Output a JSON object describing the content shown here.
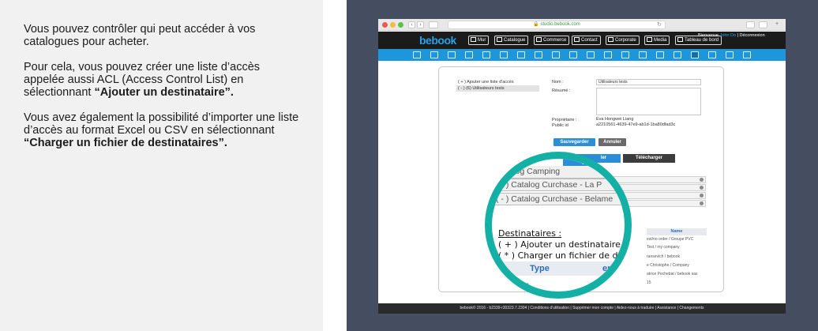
{
  "intro": {
    "p1": "Vous pouvez contrôler qui peut accéder à vos catalogues pour acheter.",
    "p2_prefix": "Pour cela, vous pouvez créer une liste d’accès appelée aussi ACL (Access Control List) en sélectionnant ",
    "p2_bold": "“Ajouter un destinataire”.",
    "p3_prefix": "Vous avez également la possibilité d’importer une liste d’accès au format Excel ou CSV en sélectionnant ",
    "p3_bold": "“Charger un fichier de destinataires”."
  },
  "browser": {
    "url": "studio.bebook.com"
  },
  "app": {
    "logo": "bebook",
    "menu": [
      {
        "label": "Mur",
        "icon": "edit-icon"
      },
      {
        "label": "Catalogue",
        "icon": "catalog-icon"
      },
      {
        "label": "Commerce",
        "icon": "cart-icon"
      },
      {
        "label": "Contact",
        "icon": "contacts-icon"
      },
      {
        "label": "Corporate",
        "icon": "corporate-icon"
      },
      {
        "label": "Media",
        "icon": "media-icon"
      },
      {
        "label": "Tableau de bord",
        "icon": "dashboard-icon"
      }
    ],
    "user": {
      "line1_a": "Bienvenue",
      "line1_b": "John Do",
      "line1_c": "Déconnexion"
    }
  },
  "form": {
    "acl_items": [
      "( + ) Ajouter une liste d'accès",
      "( - ) (6) Utilisateurs tests"
    ],
    "nom_label": "Nom :",
    "nom_value": "Utilisateurs tests",
    "resume_label": "Résumé :",
    "proprietaire_label": "Propriétaire :",
    "proprietaire_value": "Eva Hongwei Liang",
    "public_id_label": "Public id",
    "public_id_value": "a2210561-4639-47e9-ab1d-1ba80dfad3c",
    "save_button": "Sauvegarder",
    "cancel_button": "Annuler",
    "tab_blue": "ler",
    "tab_dark": "Télécharger",
    "name_header": "Name",
    "name_cells": [
      "est/no order / Groupe PVC",
      "Test / my company",
      "ransevich / bebook",
      "e Christophe / Company",
      "atrice Pechebat / bebook sas",
      "15"
    ]
  },
  "magnifier": {
    "catalog_rows": [
      "Catalog Camping",
      "( - ) Catalog Curchase - La P",
      "( - ) Catalog Curchase - Belame"
    ],
    "blue_tab": "ler",
    "destinataires_title": "Destinataires :",
    "add_recipient": "( + ) Ajouter un destinataire",
    "upload_recipients": "( * ) Charger un fichier de destina",
    "col_type": "Type",
    "col_name": "en",
    "rows": [
      "user",
      "user",
      "user"
    ]
  },
  "footer": {
    "text": "bebook© 2016 - b2339-r30323.7.2304 | Conditions d'utilisation | Supprimer mon compte | Aidez-nous à traduire | Assistance | Changements"
  }
}
